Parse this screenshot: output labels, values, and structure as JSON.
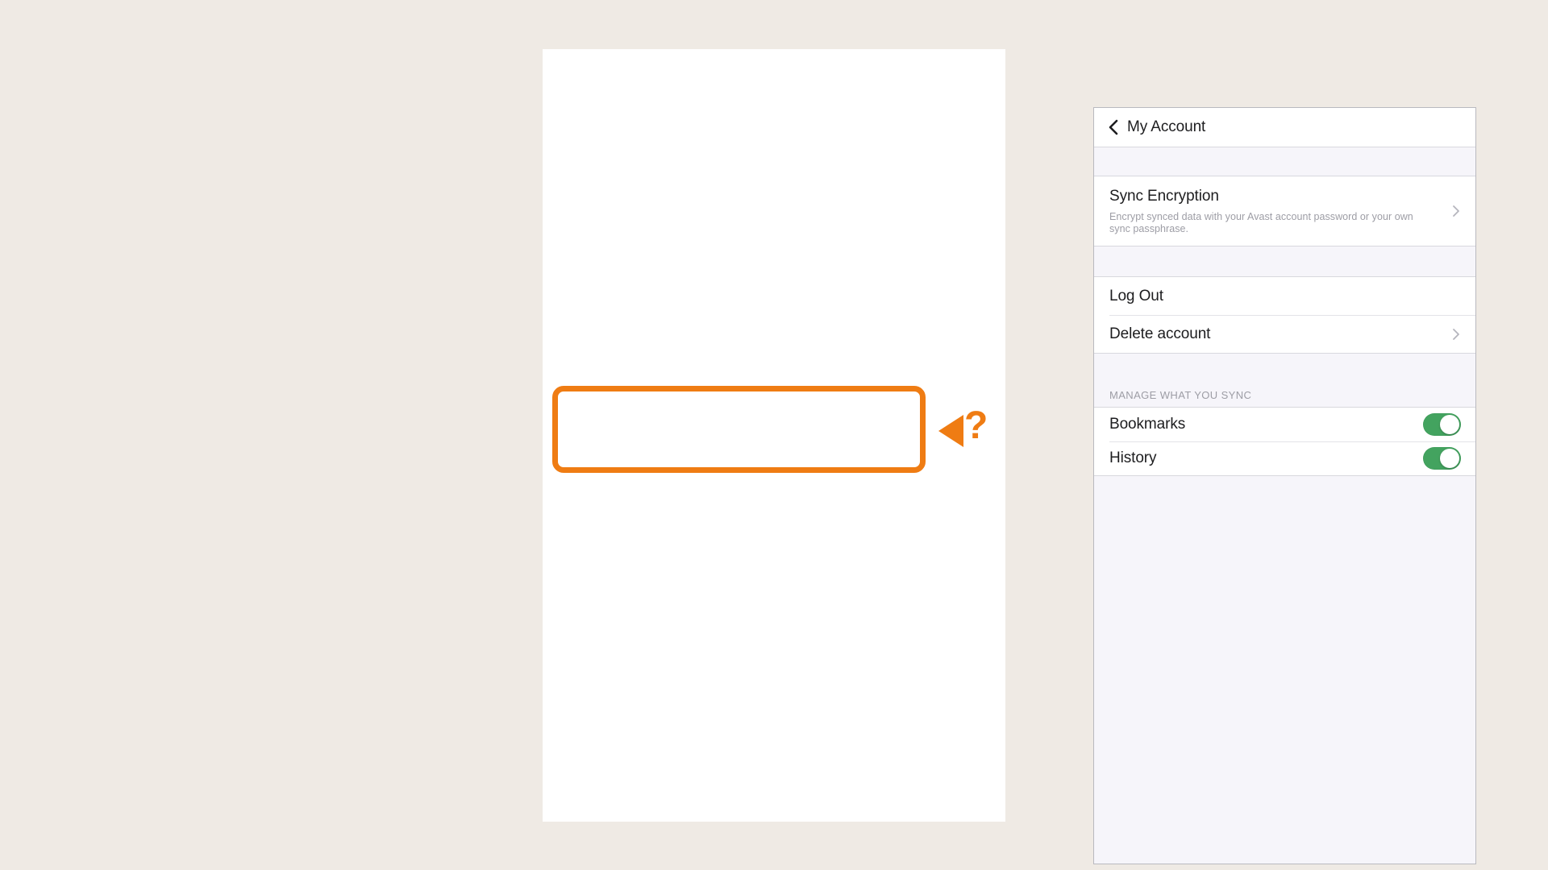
{
  "canvas": {
    "background_color": "#ffffff",
    "page_background_color": "#efeae4"
  },
  "phone": {
    "navbar": {
      "back_icon": "back-chevron-icon",
      "title": "My Account"
    },
    "sections": [
      {
        "id": "sync-encryption",
        "rows": [
          {
            "title": "Sync Encryption",
            "subtitle": "Encrypt synced data with your Avast account password or your own sync passphrase.",
            "disclosure_icon": "chevron-right-icon"
          }
        ]
      },
      {
        "id": "account-actions",
        "rows": [
          {
            "title": "Log Out",
            "disclosure_icon": null
          },
          {
            "title": "Delete account",
            "disclosure_icon": "chevron-right-icon"
          }
        ]
      },
      {
        "id": "manage-sync",
        "header": "MANAGE WHAT YOU SYNC",
        "rows": [
          {
            "title": "Bookmarks",
            "toggle": "on"
          },
          {
            "title": "History",
            "toggle": "on"
          }
        ]
      }
    ]
  },
  "annotation": {
    "highlight_color": "#ef7c13",
    "arrow_icon": "left-pointing-triangle-icon",
    "question_mark": "?",
    "toggle_on_color": "#43a35f"
  }
}
